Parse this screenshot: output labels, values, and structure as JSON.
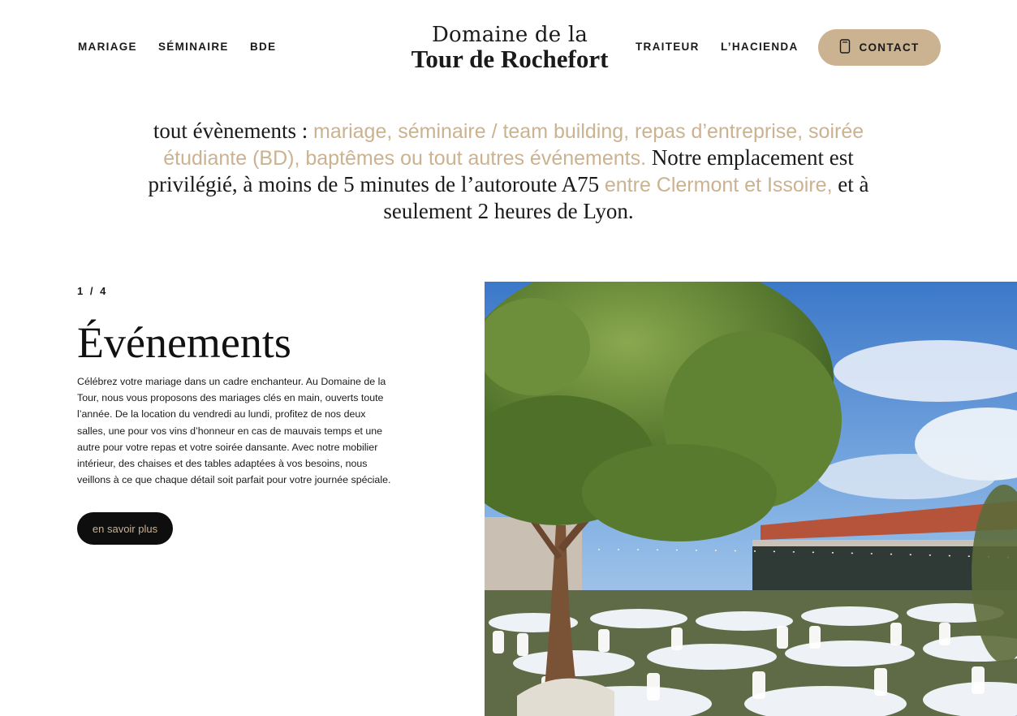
{
  "nav": {
    "left": [
      {
        "label": "MARIAGE"
      },
      {
        "label": "SÉMINAIRE"
      },
      {
        "label": "BDE"
      }
    ],
    "logo": {
      "line1": "Domaine de la",
      "line2": "Tour de Rochefort"
    },
    "right": [
      {
        "label": "TRAITEUR"
      },
      {
        "label": "L’HACIENDA"
      }
    ],
    "contact": {
      "label": "CONTACT",
      "icon": "phone-icon"
    }
  },
  "intro": {
    "p1": "tout évènements : ",
    "p2": "mariage, séminaire / team building, repas d’entreprise, soirée étudiante (BD), baptêmes ou tout autres événements.",
    "p3": " Notre emplacement est privilégié, à moins de 5 minutes de l’autoroute A75 ",
    "p4": "entre Clermont et Issoire,",
    "p5": " et à seulement 2 heures de Lyon."
  },
  "slide": {
    "current": "1",
    "separator": "/",
    "total": "4",
    "title": "Événements",
    "description": "Célébrez votre mariage dans un cadre enchanteur. Au Domaine de la Tour, nous vous proposons des mariages clés en main, ouverts toute l’année. De la location du vendredi au lundi, profitez de nos deux salles, une pour vos vins d’honneur en cas de mauvais temps et une autre pour votre repas et votre soirée dansante. Avec notre mobilier intérieur, des chaises et des tables adaptées à vos besoins, nous veillons à ce que chaque détail soit parfait pour votre journée spéciale.",
    "button": "en savoir plus"
  },
  "colors": {
    "accent": "#cbb290",
    "text": "#1a1a1a",
    "button_dark": "#0e0e0e"
  }
}
